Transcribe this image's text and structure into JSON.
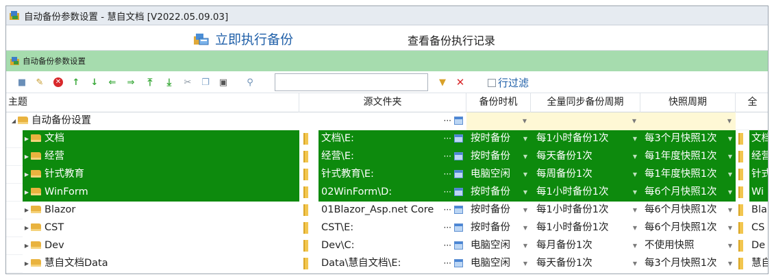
{
  "window": {
    "title": "自动备份参数设置 - 慧自文档 [V2022.05.09.03]"
  },
  "topbar": {
    "run_label": "立即执行备份",
    "log_label": "查看备份执行记录"
  },
  "panel": {
    "title": "自动备份参数设置"
  },
  "toolbar": {
    "filter_value": "",
    "row_filter_label": "行过滤"
  },
  "columns": [
    "主题",
    "源文件夹",
    "备份时机",
    "全量同步备份周期",
    "快照周期",
    "全"
  ],
  "group_row": {
    "label": "自动备份设置"
  },
  "rows": [
    {
      "theme": "文档",
      "source": "文档\\E:",
      "timing": "按时备份",
      "cycle": "每1小时备份1次",
      "snapshot": "每3个月快照1次",
      "next": "文档",
      "selected": true
    },
    {
      "theme": "经营",
      "source": "经营\\E:",
      "timing": "按时备份",
      "cycle": "每天备份1次",
      "snapshot": "每1年度快照1次",
      "next": "经营",
      "selected": true
    },
    {
      "theme": "针式教育",
      "source": "针式教育\\E:",
      "timing": "电脑空闲",
      "cycle": "每周备份1次",
      "snapshot": "每1年度快照1次",
      "next": "针式",
      "selected": true
    },
    {
      "theme": "WinForm",
      "source": "02WinForm\\D:",
      "timing": "按时备份",
      "cycle": "每1小时备份1次",
      "snapshot": "每6个月快照1次",
      "next": "Wi",
      "selected": true
    },
    {
      "theme": "Blazor",
      "source": "01Blazor_Asp.net Core",
      "timing": "按时备份",
      "cycle": "每1小时备份1次",
      "snapshot": "每6个月快照1次",
      "next": "Bla",
      "selected": false
    },
    {
      "theme": "CST",
      "source": "CST\\E:",
      "timing": "按时备份",
      "cycle": "每1小时备份1次",
      "snapshot": "每6个月快照1次",
      "next": "CS",
      "selected": false
    },
    {
      "theme": "Dev",
      "source": "Dev\\C:",
      "timing": "电脑空闲",
      "cycle": "每月备份1次",
      "snapshot": "不使用快照",
      "next": "De",
      "selected": false
    },
    {
      "theme": "慧自文档Data",
      "source": "Data\\慧自文档\\E:",
      "timing": "电脑空闲",
      "cycle": "每天备份1次",
      "snapshot": "每3个月快照1次",
      "next": "慧自",
      "selected": false
    }
  ],
  "colors": {
    "selected_row": "#0d8a0d",
    "group_bar": "#a6dcae",
    "editor_row": "#fef8d5",
    "link_blue": "#1f5fa8"
  }
}
